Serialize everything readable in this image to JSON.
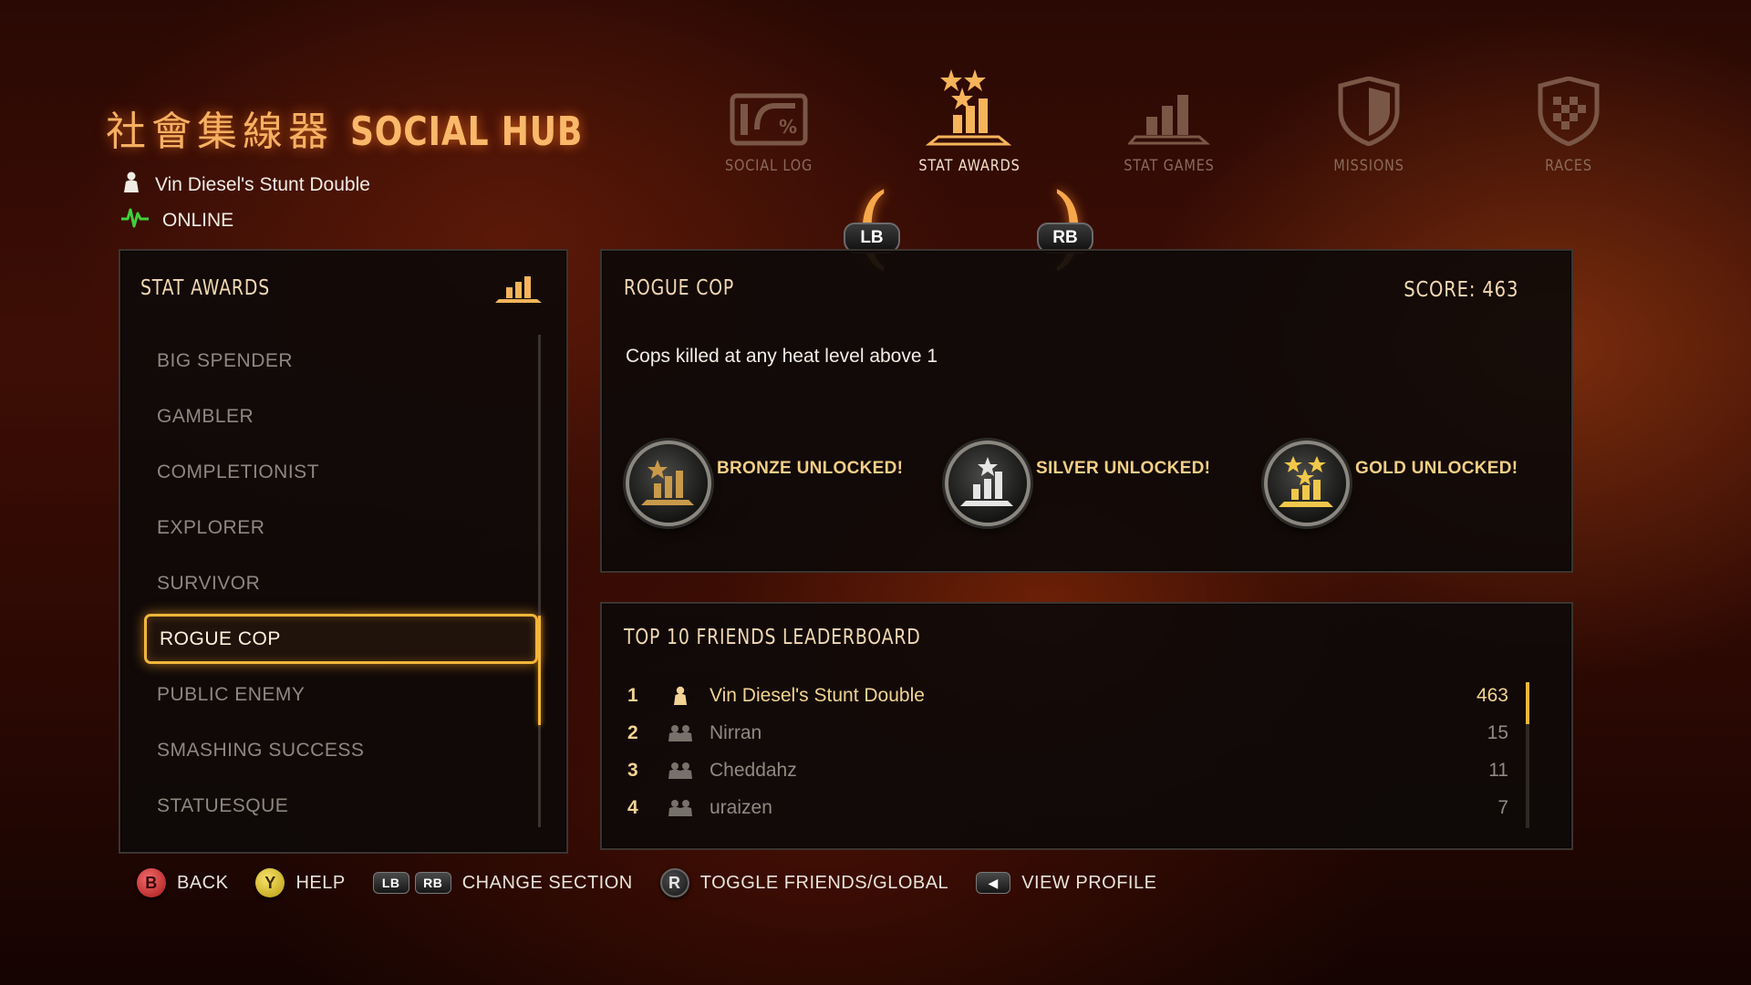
{
  "header": {
    "title_cn": "社會集線器",
    "title_en": "SOCIAL HUB",
    "player_name": "Vin Diesel's Stunt Double",
    "status": "ONLINE"
  },
  "tabs": [
    {
      "label": "SOCIAL LOG",
      "icon": "social-log-icon",
      "active": false
    },
    {
      "label": "STAT AWARDS",
      "icon": "stat-awards-icon",
      "active": true
    },
    {
      "label": "STAT GAMES",
      "icon": "stat-games-icon",
      "active": false
    },
    {
      "label": "MISSIONS",
      "icon": "missions-shield-icon",
      "active": false
    },
    {
      "label": "RACES",
      "icon": "races-shield-icon",
      "active": false
    }
  ],
  "bumpers": {
    "left": "LB",
    "right": "RB"
  },
  "stat_awards": {
    "title": "STAT AWARDS",
    "items": [
      "BIG SPENDER",
      "GAMBLER",
      "COMPLETIONIST",
      "EXPLORER",
      "SURVIVOR",
      "ROGUE COP",
      "PUBLIC ENEMY",
      "SMASHING SUCCESS",
      "STATUESQUE"
    ],
    "selected_index": 5
  },
  "detail": {
    "title": "ROGUE COP",
    "score": "SCORE: 463",
    "description": "Cops killed at any heat level above 1",
    "medals": [
      {
        "label": "BRONZE UNLOCKED!",
        "tier": "bronze",
        "color": "#c99a4a"
      },
      {
        "label": "SILVER UNLOCKED!",
        "tier": "silver",
        "color": "#e6e6e6"
      },
      {
        "label": "GOLD UNLOCKED!",
        "tier": "gold",
        "color": "#f1c84a"
      }
    ]
  },
  "leaderboard": {
    "title": "TOP 10 FRIENDS LEADERBOARD",
    "rows": [
      {
        "rank": "1",
        "name": "Vin Diesel's Stunt Double",
        "score": "463",
        "is_player": true
      },
      {
        "rank": "2",
        "name": "Nirran",
        "score": "15",
        "is_player": false
      },
      {
        "rank": "3",
        "name": "Cheddahz",
        "score": "11",
        "is_player": false
      },
      {
        "rank": "4",
        "name": "uraizen",
        "score": "7",
        "is_player": false
      }
    ]
  },
  "footer": {
    "back": {
      "button": "B",
      "label": "BACK"
    },
    "help": {
      "button": "Y",
      "label": "HELP"
    },
    "change": {
      "lb": "LB",
      "rb": "RB",
      "label": "CHANGE SECTION"
    },
    "toggle": {
      "button": "R",
      "label": "TOGGLE FRIENDS/GLOBAL"
    },
    "profile": {
      "label": "VIEW PROFILE"
    }
  },
  "colors": {
    "accent": "#f2b63a",
    "title_glow": "#f9b86a",
    "online_green": "#3fd13b"
  }
}
